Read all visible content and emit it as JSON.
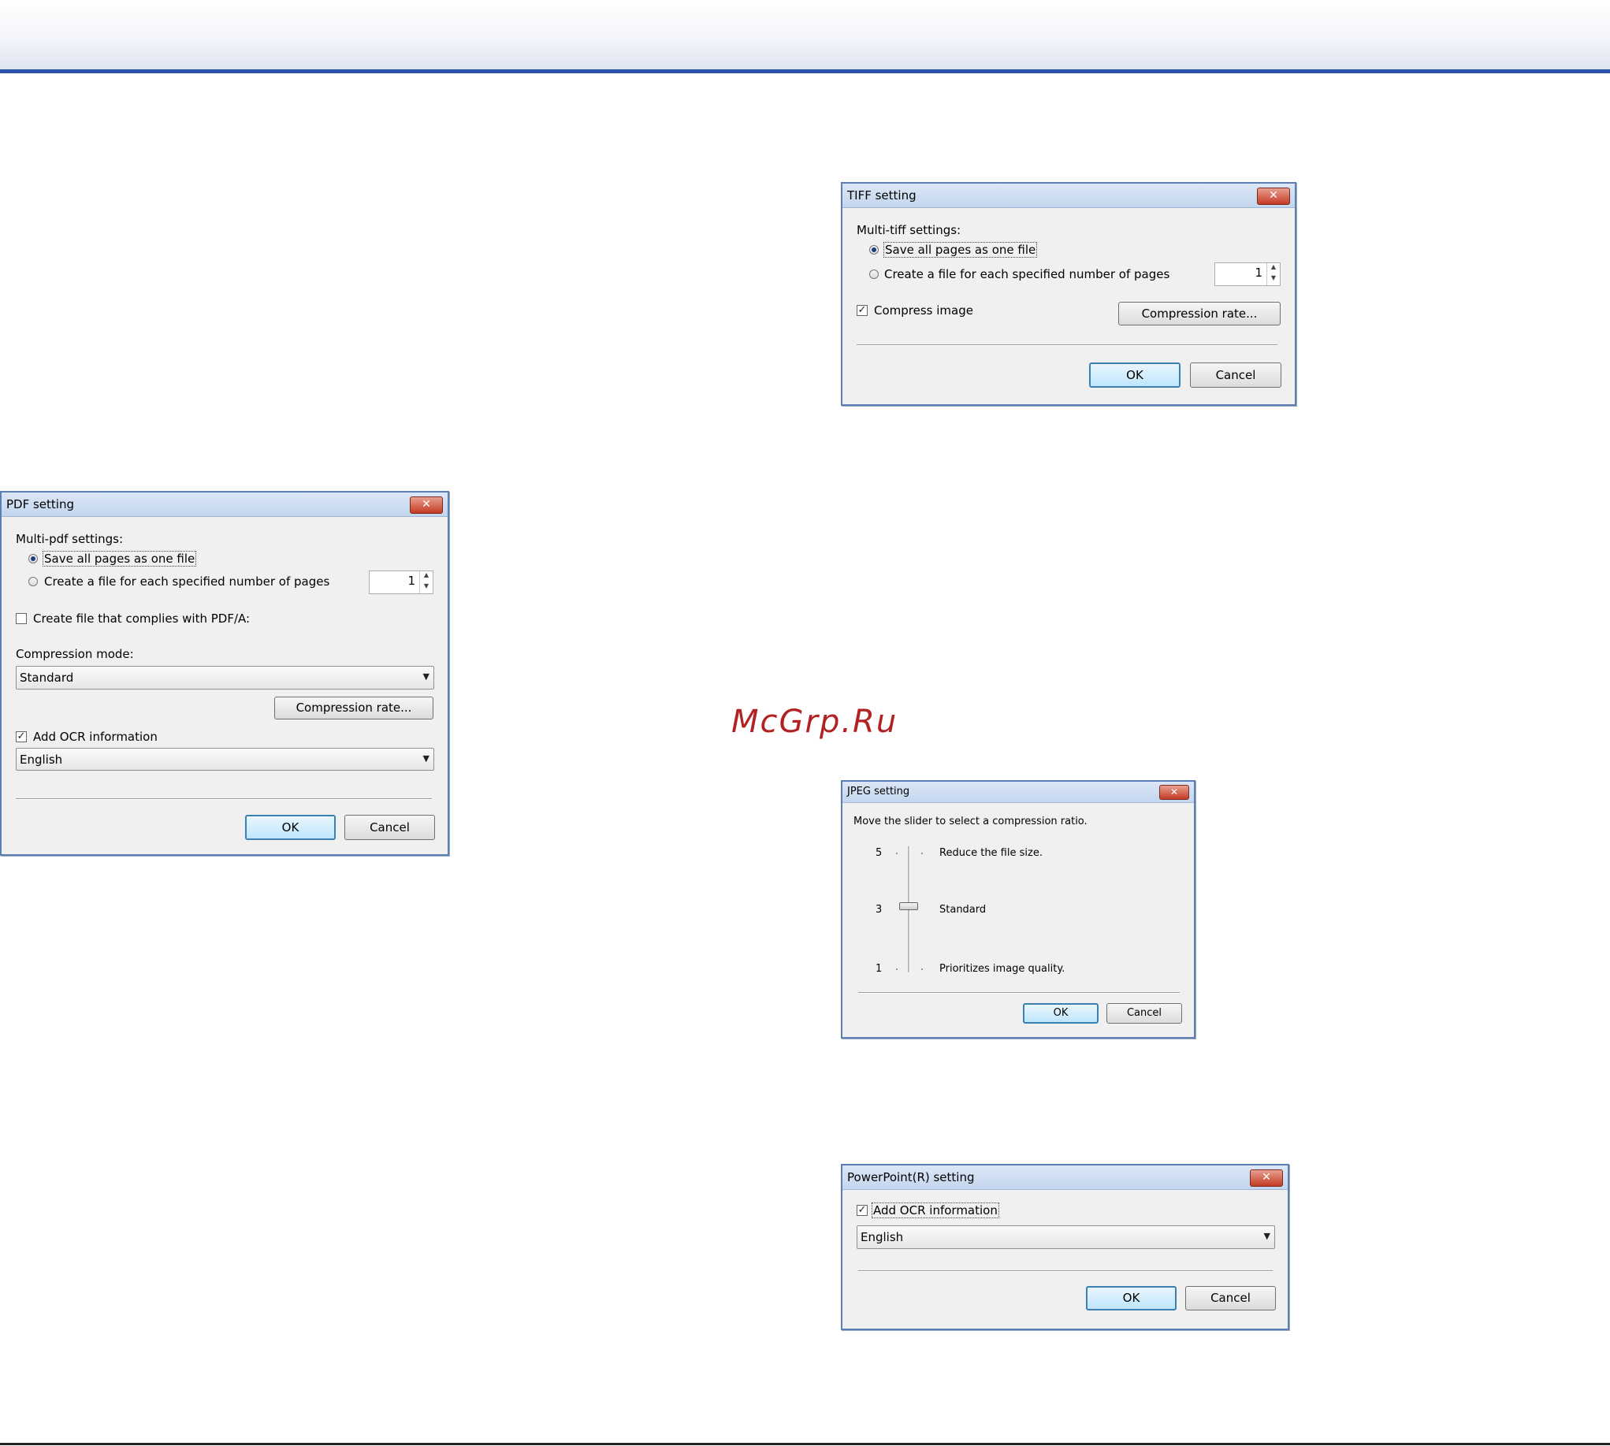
{
  "watermark": "McGrp.Ru",
  "tiff": {
    "title": "TIFF setting",
    "close": "✕",
    "group_label": "Multi-tiff settings:",
    "radio_all": "Save all pages as one file",
    "radio_each": "Create a file for each specified number of pages",
    "spin_value": "1",
    "compress_label": "Compress image",
    "compress_checked": true,
    "compression_rate_button": "Compression rate...",
    "ok": "OK",
    "cancel": "Cancel"
  },
  "pdf": {
    "title": "PDF setting",
    "close": "✕",
    "group_label": "Multi-pdf settings:",
    "radio_all": "Save all pages as one file",
    "radio_each": "Create a file for each specified number of pages",
    "spin_value": "1",
    "pdfa_label": "Create file that complies with PDF/A:",
    "pdfa_checked": false,
    "compression_mode_label": "Compression mode:",
    "compression_mode_value": "Standard",
    "compression_rate_button": "Compression rate...",
    "ocr_label": "Add OCR information",
    "ocr_checked": true,
    "language_value": "English",
    "ok": "OK",
    "cancel": "Cancel"
  },
  "jpeg": {
    "title": "JPEG setting",
    "close": "✕",
    "instruction": "Move the slider to select a compression ratio.",
    "level_max": "5",
    "level_mid": "3",
    "level_min": "1",
    "desc_max": "Reduce the file size.",
    "desc_mid": "Standard",
    "desc_min": "Prioritizes image quality.",
    "slider_value": 3,
    "ok": "OK",
    "cancel": "Cancel"
  },
  "ppt": {
    "title": "PowerPoint(R) setting",
    "close": "✕",
    "ocr_label": "Add OCR information",
    "ocr_checked": true,
    "language_value": "English",
    "ok": "OK",
    "cancel": "Cancel"
  },
  "icons": {
    "check": "✓",
    "arrow_down": "▼",
    "arrow_up": "▲"
  }
}
